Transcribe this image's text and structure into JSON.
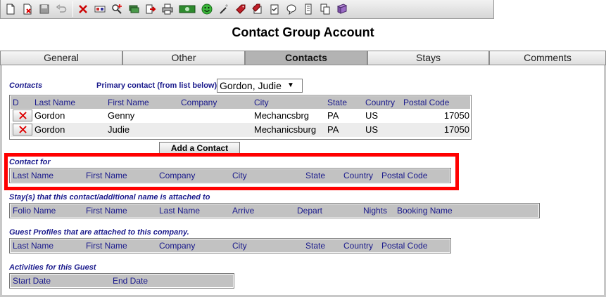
{
  "toolbar": {
    "buttons": [
      {
        "icon": "new-document-icon"
      },
      {
        "icon": "delete-document-icon"
      },
      {
        "icon": "save-icon"
      },
      {
        "icon": "undo-icon"
      },
      {
        "icon": "close-x-icon"
      },
      {
        "icon": "card-icon"
      },
      {
        "icon": "search-add-icon"
      },
      {
        "icon": "money-stack-icon"
      },
      {
        "icon": "export-icon"
      },
      {
        "icon": "print-icon"
      },
      {
        "icon": "cash-icon"
      },
      {
        "icon": "smiley-icon"
      },
      {
        "icon": "wand-icon"
      },
      {
        "icon": "tag-icon"
      },
      {
        "icon": "gift-tag-icon"
      },
      {
        "icon": "checklist-icon"
      },
      {
        "icon": "speech-bubble-icon"
      },
      {
        "icon": "scroll-icon"
      },
      {
        "icon": "copy-document-icon"
      },
      {
        "icon": "book-icon"
      }
    ]
  },
  "page": {
    "title": "Contact Group Account"
  },
  "tabs": [
    {
      "label": "General",
      "active": false
    },
    {
      "label": "Other",
      "active": false
    },
    {
      "label": "Contacts",
      "active": true
    },
    {
      "label": "Stays",
      "active": false
    },
    {
      "label": "Comments",
      "active": false
    }
  ],
  "contacts": {
    "section_label": "Contacts",
    "primary_label": "Primary contact (from list below)",
    "primary_value": "Gordon, Judie",
    "columns": [
      "D",
      "Last Name",
      "First Name",
      "Company",
      "City",
      "State",
      "Country",
      "Postal Code"
    ],
    "rows": [
      {
        "last": "Gordon",
        "first": "Genny",
        "company": "",
        "city": "Mechancsbrg",
        "state": "PA",
        "country": "US",
        "postal": "17050"
      },
      {
        "last": "Gordon",
        "first": "Judie",
        "company": "",
        "city": "Mechanicsburg",
        "state": "PA",
        "country": "US",
        "postal": "17050"
      }
    ],
    "add_button": "Add a Contact"
  },
  "contact_for": {
    "section_label": "Contact for",
    "columns": [
      "Last Name",
      "First Name",
      "Company",
      "City",
      "State",
      "Country",
      "Postal Code"
    ]
  },
  "stays": {
    "section_label": "Stay(s) that this contact/additional name is attached to",
    "columns": [
      "Folio Name",
      "First Name",
      "Last Name",
      "Arrive",
      "Depart",
      "Nights",
      "Booking Name"
    ]
  },
  "guest_profiles": {
    "section_label": "Guest Profiles that are attached to this company.",
    "columns": [
      "Last Name",
      "First Name",
      "Company",
      "City",
      "State",
      "Country",
      "Postal Code"
    ]
  },
  "activities": {
    "section_label": "Activities for this Guest",
    "columns": [
      "Start Date",
      "End Date"
    ]
  },
  "colors": {
    "label_blue": "#1a1a8c",
    "header_gray": "#c2c2c2",
    "highlight_red": "#ff0000"
  }
}
